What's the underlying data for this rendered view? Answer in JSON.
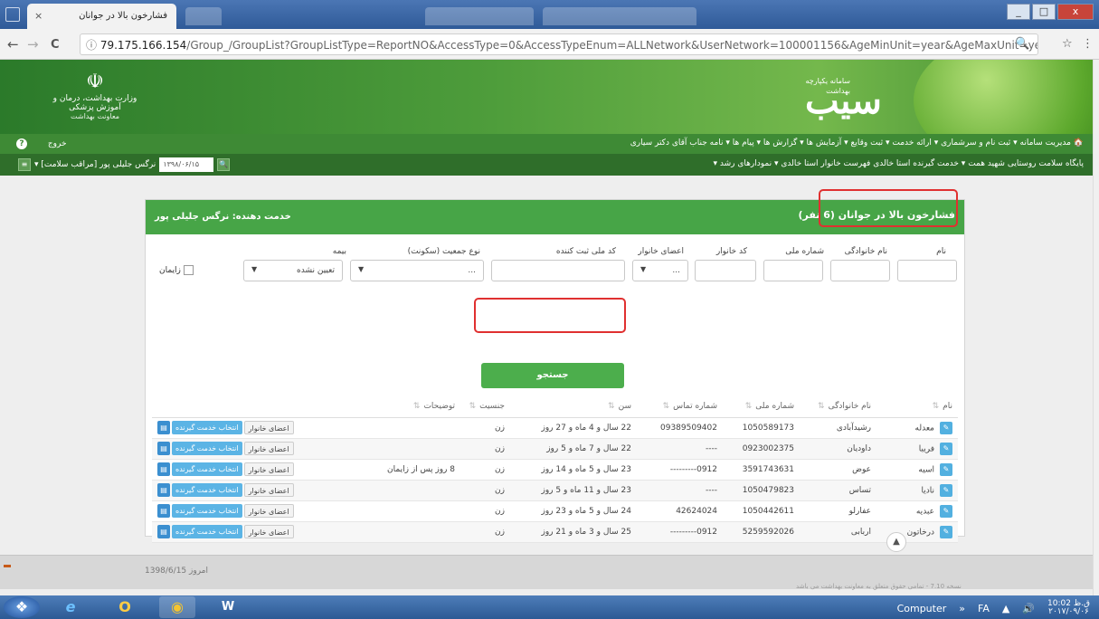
{
  "browser": {
    "tab_title": "فشارخون بالا در جوانان",
    "tab_close": "×",
    "url_host": "79.175.166.154",
    "url_path": "/Group_/GroupList?GroupListType=ReportNO&AccessType=0&AccessTypeEnum=ALLNetwork&UserNetwork=100001156&AgeMinUnit=year&AgeMaxUnit=year&R...",
    "back": "←",
    "forward": "→",
    "reload": "C",
    "info_icon": "ⓘ",
    "zoom_icon": "🔍",
    "star_icon": "☆",
    "menu_icon": "⋮"
  },
  "window_buttons": {
    "min": "_",
    "max": "□",
    "close": "x"
  },
  "banner": {
    "emblem_symbol": "☫",
    "ministry_line1": "وزارت بهداشت، درمان و آموزش پزشکی",
    "ministry_line2": "معاونت بهداشت",
    "logo_text": "سیب",
    "logo_sub": "سامانه یکپارچه بهداشت"
  },
  "nav1": {
    "items": "🏠  مدیریت سامانه ▾   ثبت نام و سرشماری ▾   ارائه خدمت ▾   ثبت وقایع ▾   آزمایش ها ▾   گزارش ها ▾   پیام ها ▾   نامه جناب آقای دکتر سیاری",
    "logout": "خروج",
    "help_icon": "?"
  },
  "nav2": {
    "items": "پایگاه سلامت روستایی شهید همت ▾    خدمت گیرنده استا خالدی    فهرست خانوار استا خالدی ▾    نمودارهای رشد ▾",
    "date_value": "۱۳۹۸/۰۶/۱۵",
    "user_name": "نرگس جلیلی پور [مراقب سلامت] ▾",
    "search_icon": "🔍"
  },
  "panel": {
    "title": "فشارخون بالا در جوانان (6 نفر)",
    "provider": "خدمت دهنده: نرگس جلیلی پور",
    "search_label": "جستجو",
    "checkbox_label": "زایمان",
    "filters": [
      {
        "label": "نام",
        "value": ""
      },
      {
        "label": "نام خانوادگی",
        "value": ""
      },
      {
        "label": "شماره ملی",
        "value": ""
      },
      {
        "label": "کد خانوار",
        "value": ""
      },
      {
        "label": "اعضای خانوار",
        "value": "..."
      },
      {
        "label": "کد ملی ثبت کننده",
        "value": ""
      },
      {
        "label": "نوع جمعیت (سکونت)",
        "value": "..."
      },
      {
        "label": "بیمه",
        "value": "تعیین نشده"
      }
    ]
  },
  "table": {
    "columns": [
      "نام",
      "نام خانوادگی",
      "شماره ملی",
      "شماره تماس",
      "سن",
      "جنسیت",
      "توضیحات"
    ],
    "sort_icon": "⇅",
    "edit_icon": "✎",
    "family_btn": "اعضای خانوار",
    "select_btn": "انتخاب خدمت گیرنده",
    "doc_icon": "▤",
    "rows": [
      {
        "name": "معدله",
        "family": "رشیدآبادی",
        "national_id": "1050589173",
        "phone": "09389509402",
        "age": "22 سال و 4 ماه و 27 روز",
        "gender": "زن",
        "note": ""
      },
      {
        "name": "فریبا",
        "family": "داودیان",
        "national_id": "0923002375",
        "phone": "----",
        "age": "22 سال و 7 ماه و 5 روز",
        "gender": "زن",
        "note": ""
      },
      {
        "name": "اسیه",
        "family": "عوض",
        "national_id": "3591743631",
        "phone": "---------0912",
        "age": "23 سال و 5 ماه و 14 روز",
        "gender": "زن",
        "note": "8 روز پس از زایمان"
      },
      {
        "name": "نادیا",
        "family": "تساس",
        "national_id": "1050479823",
        "phone": "----",
        "age": "23 سال و 11 ماه و 5 روز",
        "gender": "زن",
        "note": ""
      },
      {
        "name": "عبدیه",
        "family": "عفارلو",
        "national_id": "1050442611",
        "phone": "42624024",
        "age": "24 سال و 5 ماه و 23 روز",
        "gender": "زن",
        "note": ""
      },
      {
        "name": "درخاتون",
        "family": "اربابی",
        "national_id": "5259592026",
        "phone": "---------0912",
        "age": "25 سال و 3 ماه و 21 روز",
        "gender": "زن",
        "note": ""
      }
    ]
  },
  "footer": {
    "date": "1398/6/15 امروز",
    "version": "نسخه 7.10 - تمامی حقوق متعلق به معاونت بهداشت می باشد",
    "up_icon": "▲"
  },
  "taskbar": {
    "start_icon": "❖",
    "ie_icon": "e",
    "outlook_icon": "O",
    "chrome_icon": "◉",
    "word_icon": "W",
    "computer": "Computer",
    "lang": "FA",
    "chevrons": "»",
    "tray_up": "▲",
    "volume_icon": "🔊",
    "time": "10:02 ق.ظ",
    "date": "۲۰۱۷/۰۹/۰۶"
  }
}
